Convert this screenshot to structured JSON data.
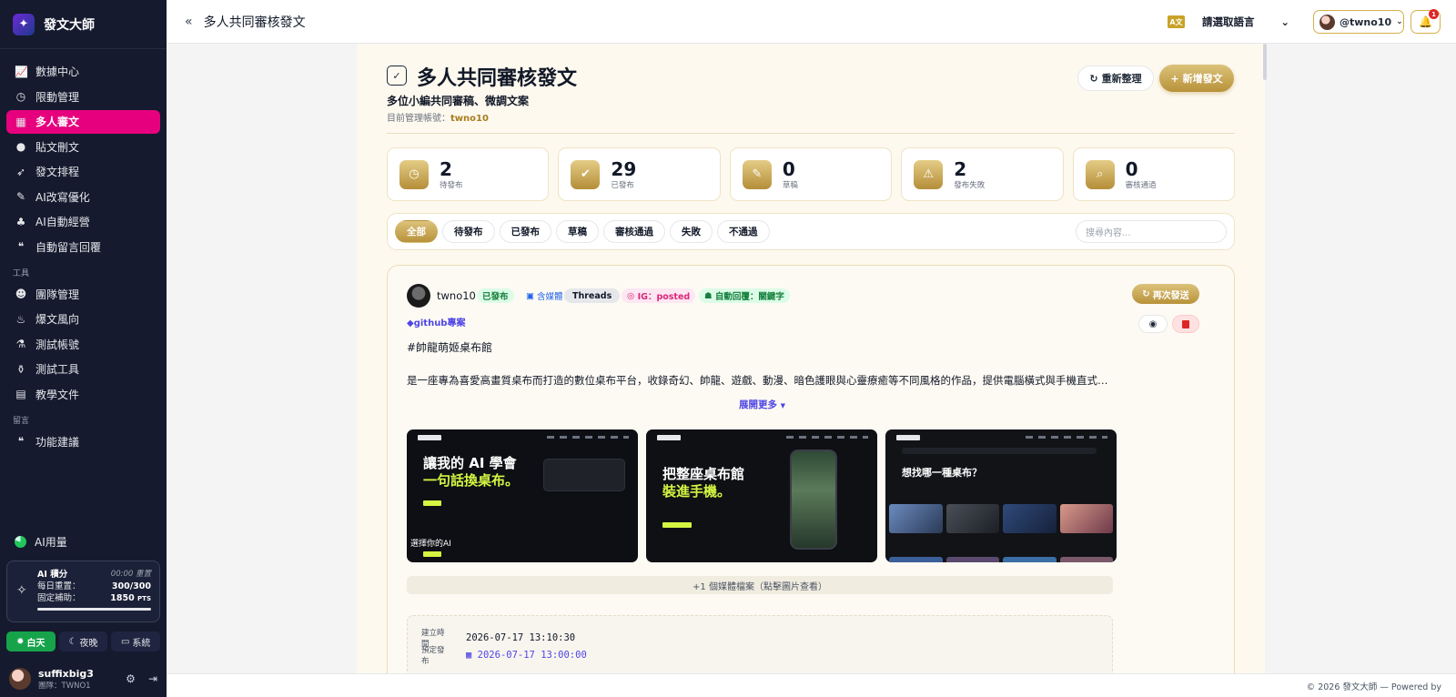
{
  "app": {
    "name": "發文大師"
  },
  "sidebar": {
    "items": [
      {
        "icon": "chart-line-icon",
        "label": "數據中心"
      },
      {
        "icon": "clock-icon",
        "label": "限動管理"
      },
      {
        "icon": "calendar-check-icon",
        "label": "多人審文",
        "active": true
      },
      {
        "icon": "user-icon",
        "label": "貼文刪文"
      },
      {
        "icon": "rocket-icon",
        "label": "發文排程"
      },
      {
        "icon": "brush-icon",
        "label": "AI改寫優化"
      },
      {
        "icon": "seedling-icon",
        "label": "AI自動經營"
      },
      {
        "icon": "comments-icon",
        "label": "自動留言回覆"
      }
    ],
    "section_tools": "工具",
    "tools": [
      {
        "icon": "users-icon",
        "label": "團隊管理"
      },
      {
        "icon": "fire-icon",
        "label": "爆文風向"
      },
      {
        "icon": "flask-icon",
        "label": "測試帳號"
      },
      {
        "icon": "beaker-icon",
        "label": "測試工具"
      },
      {
        "icon": "book-icon",
        "label": "教學文件"
      }
    ],
    "section_message": "留言",
    "message": [
      {
        "icon": "comments-icon",
        "label": "功能建議"
      }
    ],
    "ai_usage": "AI用量",
    "credits": {
      "title": "AI 積分",
      "reset": "00:00 重置",
      "daily_label": "每日重置：",
      "daily_value": "300/300",
      "fixed_label": "固定補助：",
      "fixed_value": "1850",
      "fixed_unit": "PTS",
      "daily_fraction": 1.0
    },
    "theme": {
      "light": "白天",
      "dark": "夜晚",
      "system": "系統"
    },
    "user": {
      "name": "suffixbig3",
      "team": "團隊：TWNO1"
    }
  },
  "topbar": {
    "title": "多人共同審核發文",
    "lang_badge": "A文",
    "language_placeholder": "請選取語言",
    "account": "@twno10",
    "notifications": "1"
  },
  "page": {
    "title": "多人共同審核發文",
    "subtitle": "多位小編共同審稿、微調文案",
    "account_label": "目前管理帳號：",
    "account_value": "twno10",
    "refresh": "重新整理",
    "new_post": "新增發文"
  },
  "stats": [
    {
      "icon": "clock-icon",
      "value": "2",
      "label": "待發布"
    },
    {
      "icon": "check-circle-icon",
      "value": "29",
      "label": "已發布"
    },
    {
      "icon": "edit-icon",
      "value": "0",
      "label": "草稿"
    },
    {
      "icon": "warning-icon",
      "value": "2",
      "label": "發布失敗"
    },
    {
      "icon": "search-check-icon",
      "value": "0",
      "label": "審核通過"
    }
  ],
  "filters": [
    "全部",
    "待發布",
    "已發布",
    "草稿",
    "審核通過",
    "失敗",
    "不通過"
  ],
  "search_placeholder": "搜尋內容...",
  "post": {
    "user": "twno10",
    "status": "已發布",
    "media": "含媒體",
    "platform": "Threads",
    "ig": "IG：posted",
    "auto_reply": "自動回覆：關鍵字",
    "resend": "再次發送",
    "tag": "github專案",
    "hashtag": "#帥龍萌姬桌布館",
    "body": "是一座專為喜愛高畫質桌布而打造的數位桌布平台，收錄奇幻、帥龍、遊戲、動漫、暗色護眼與心靈療癒等不同風格的作品，提供電腦橫式與手機直式桌...",
    "expand": "展開更多",
    "thumbs": [
      {
        "line1": "讓我的 AI 學會",
        "line2": "一句話換桌布。",
        "caption": "選擇你的AI"
      },
      {
        "line1": "把整座桌布館",
        "line2": "裝進手機。",
        "caption": ""
      },
      {
        "line1": "想找哪一種桌布？",
        "line2": "",
        "caption": ""
      }
    ],
    "more_media": "+1 個媒體檔案（點擊圖片查看）",
    "created_label": "建立時間",
    "created_value": "2026-07-17 13:10:30",
    "scheduled_label": "預定發布",
    "scheduled_value": "2026-07-17 13:00:00"
  },
  "footer": "© 2026 發文大師 — Powered by"
}
